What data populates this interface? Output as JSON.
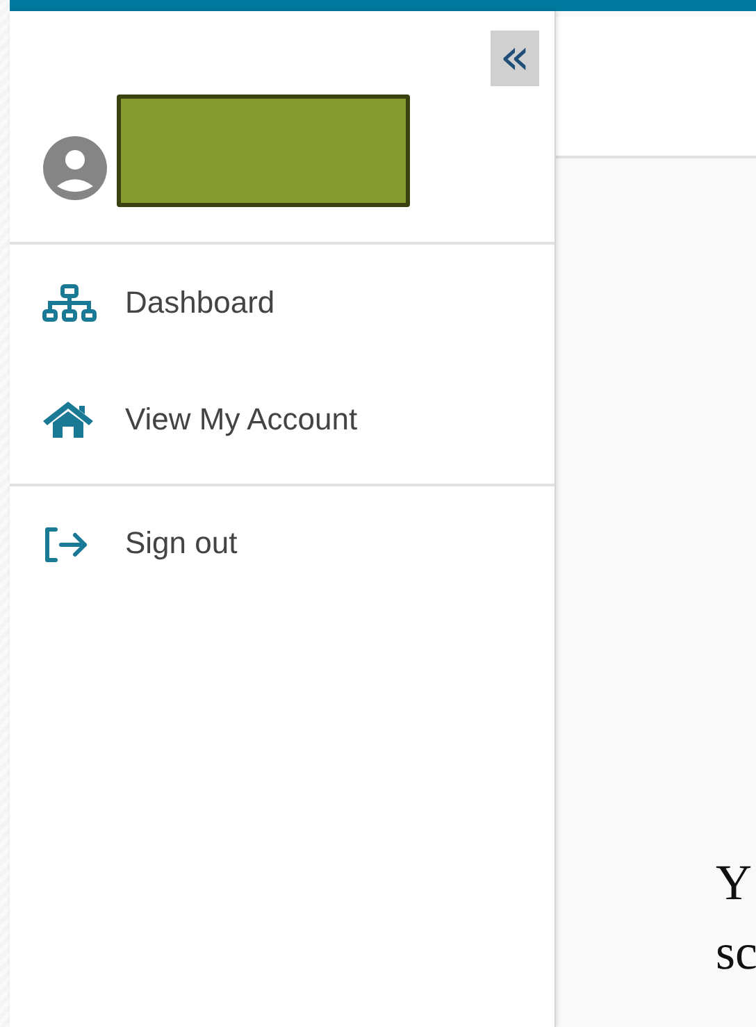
{
  "sidebar": {
    "collapse_button": {
      "label": "«"
    },
    "user": {
      "name_redacted": true
    },
    "menu": [
      {
        "kind": "sitemap",
        "label": "Dashboard"
      },
      {
        "kind": "home",
        "label": "View My Account"
      }
    ],
    "footer_menu": [
      {
        "kind": "signout",
        "label": "Sign out"
      }
    ]
  },
  "main": {
    "text_lines": [
      "Y",
      "sc"
    ]
  }
}
